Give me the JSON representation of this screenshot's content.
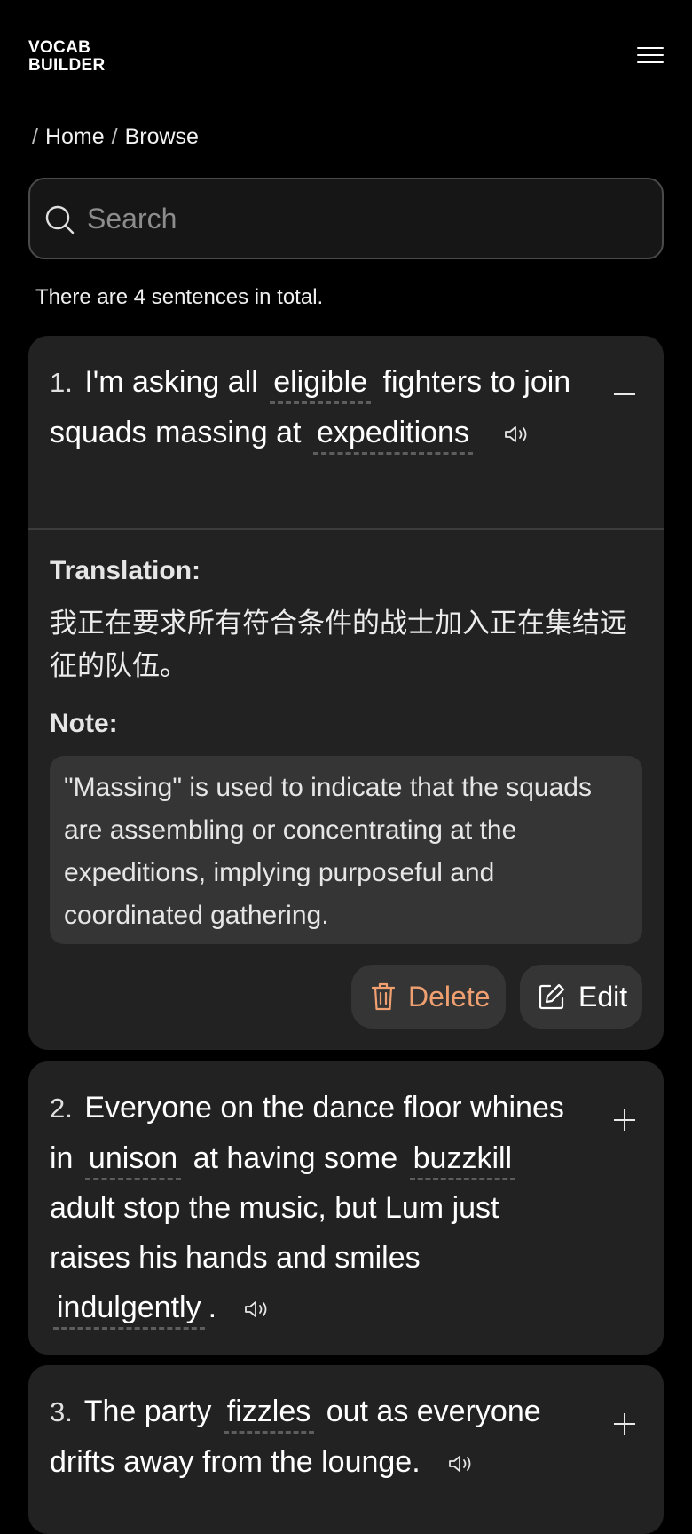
{
  "header": {
    "logo_line1": "VOCAB",
    "logo_line2": "BUILDER",
    "menu_icon": "hamburger-icon"
  },
  "breadcrumb": {
    "separator": "/",
    "items": [
      "Home",
      "Browse"
    ]
  },
  "search": {
    "placeholder": "Search",
    "value": "",
    "icon": "search-icon"
  },
  "summary": {
    "text": "There are 4 sentences in total."
  },
  "sentences": [
    {
      "number": "1.",
      "expanded": true,
      "toggle_icon": "collapse-minus-icon",
      "parts": {
        "t1": "I'm asking all",
        "v1": "eligible",
        "t2": "fighters to join squads massing at",
        "v2": "expeditions",
        "t3": ""
      },
      "translation_label": "Translation:",
      "translation": "我正在要求所有符合条件的战士加入正在集结远征的队伍。",
      "note_label": "Note:",
      "note": "\"Massing\" is used to indicate that the squads are assembling or concentrating at the expeditions, implying purposeful and coordinated gathering.",
      "delete_label": "Delete",
      "edit_label": "Edit"
    },
    {
      "number": "2.",
      "expanded": false,
      "toggle_icon": "expand-plus-icon",
      "parts": {
        "t1": "Everyone on the dance floor whines in",
        "v1": "unison",
        "t2": "at having some",
        "v2": "buzzkill",
        "t3": "adult stop the music, but Lum just raises his hands and smiles",
        "v3": "indulgently",
        "t4": "."
      }
    },
    {
      "number": "3.",
      "expanded": false,
      "toggle_icon": "expand-plus-icon",
      "parts": {
        "t1": "The party",
        "v1": "fizzles",
        "t2": "out as everyone drifts away from the lounge."
      }
    }
  ],
  "colors": {
    "background": "#000000",
    "card": "#222222",
    "note_box": "#353535",
    "delete_accent": "#f0a070",
    "vocab_underline": "#5d5d5d"
  }
}
